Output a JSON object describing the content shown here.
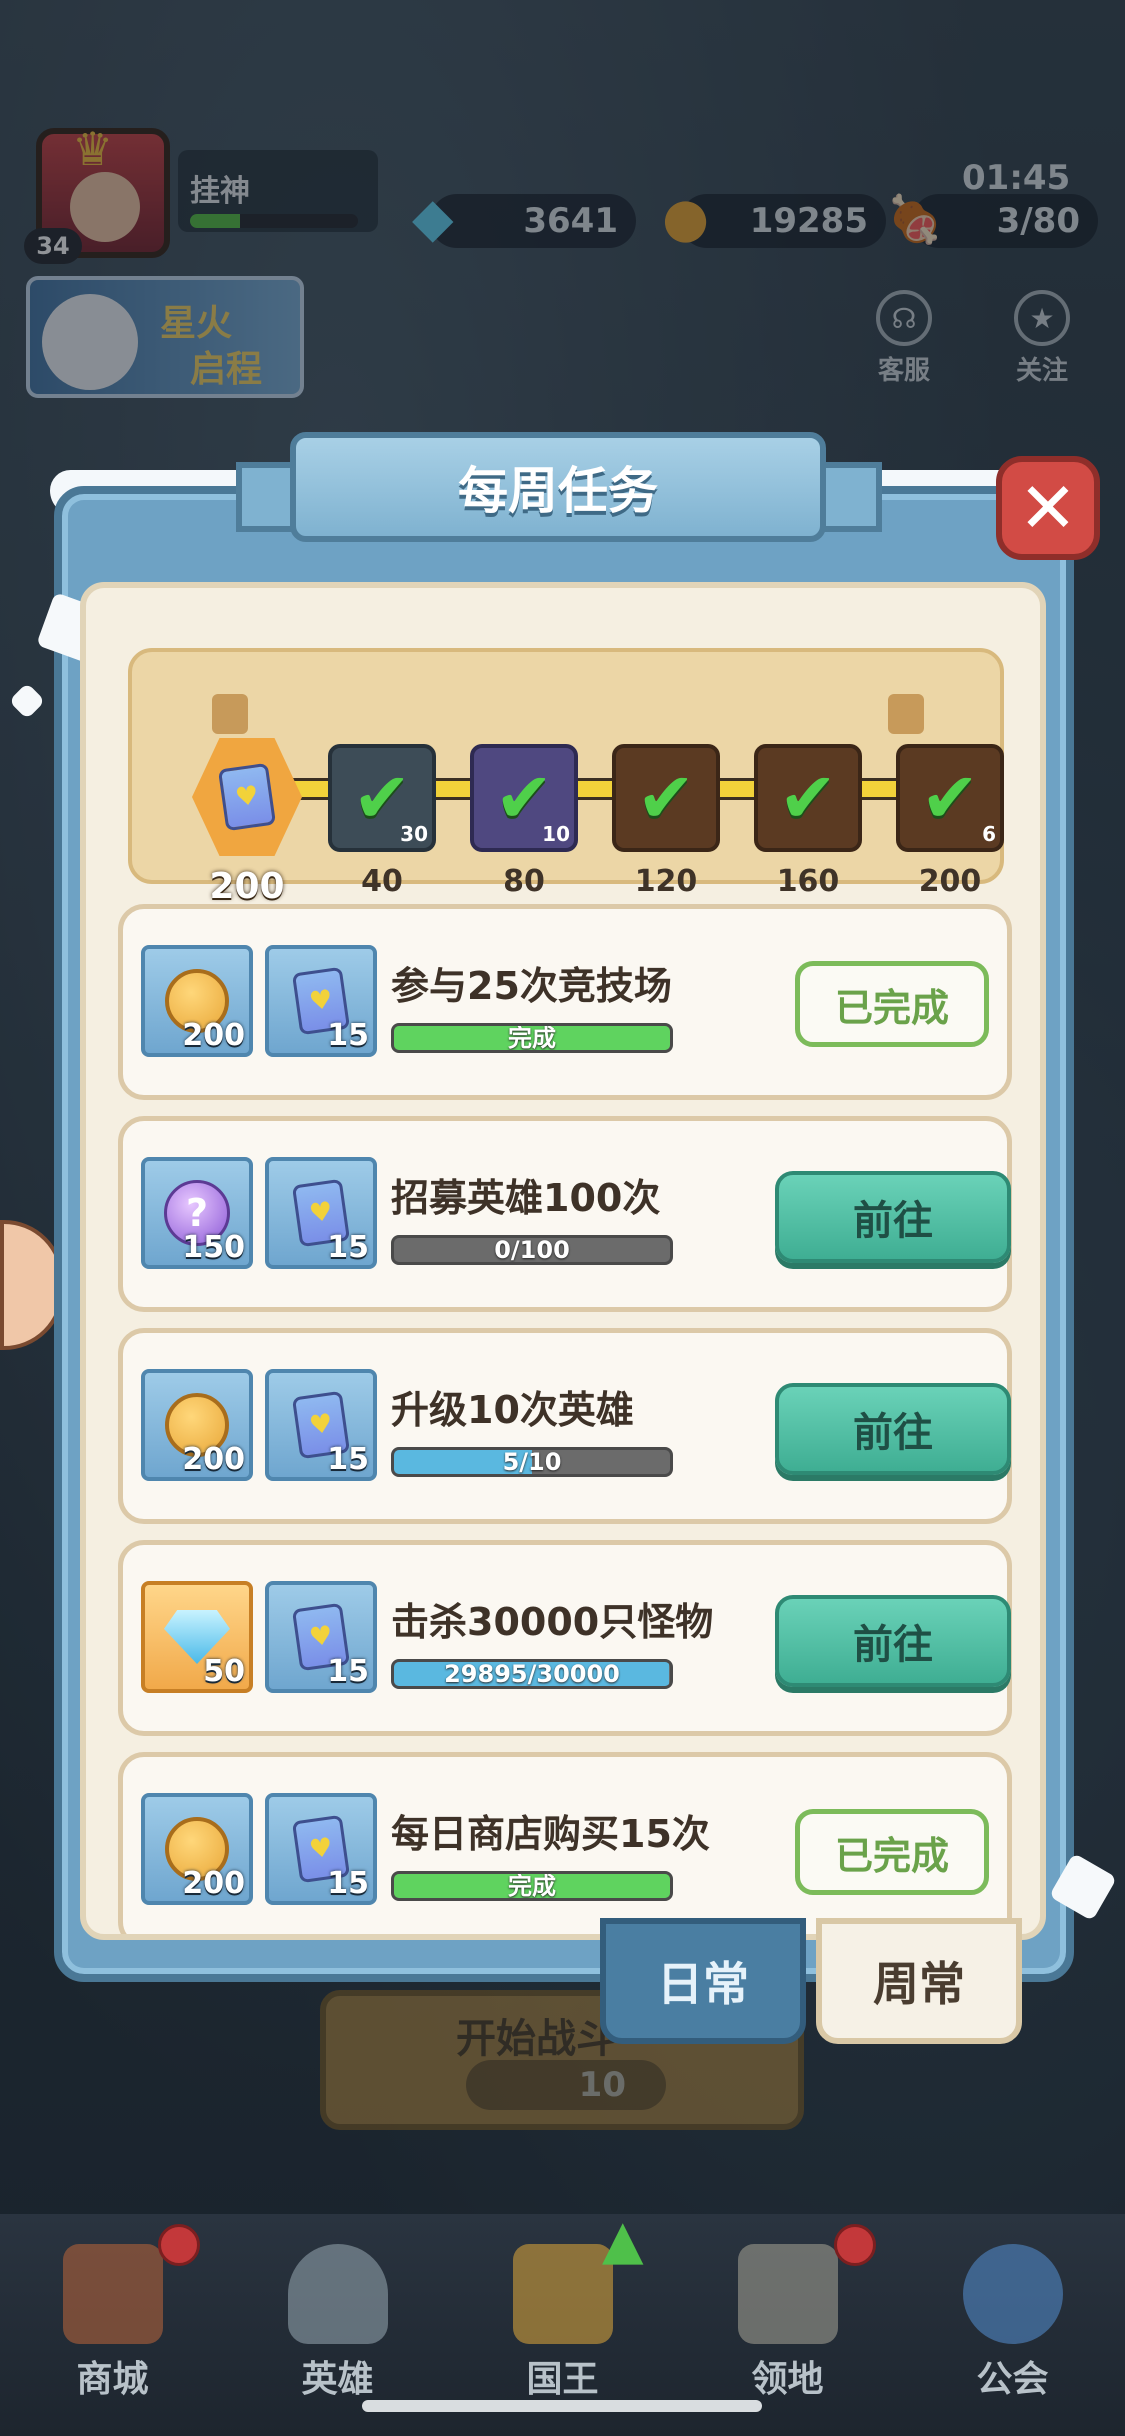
{
  "hud": {
    "level": "34",
    "name": "挂神",
    "gems": "3641",
    "gold": "19285",
    "meat": "3/80",
    "time": "01:45",
    "event_line1": "星火",
    "event_line2": "启程",
    "service_label": "客服",
    "follow_label": "关注"
  },
  "modal": {
    "title": "每周任务",
    "close_icon": "close-icon",
    "progress": {
      "current_value": "200",
      "milestones": [
        {
          "label": "40",
          "count": "30",
          "claimed": true
        },
        {
          "label": "80",
          "count": "10",
          "claimed": true
        },
        {
          "label": "120",
          "count": "",
          "claimed": true
        },
        {
          "label": "160",
          "count": "",
          "claimed": true
        },
        {
          "label": "200",
          "count": "6",
          "claimed": true
        }
      ]
    },
    "tasks": [
      {
        "title": "参与25次竞技场",
        "rewards": [
          {
            "icon": "gold-coin",
            "qty": "200"
          },
          {
            "icon": "hero-card",
            "qty": "15"
          }
        ],
        "progress_text": "完成",
        "progress_fraction": 1.0,
        "bar_color": "#5fd35f",
        "status": "done",
        "button_label": "已完成"
      },
      {
        "title": "招募英雄100次",
        "rewards": [
          {
            "icon": "mystery-orb",
            "qty": "150"
          },
          {
            "icon": "hero-card",
            "qty": "15"
          }
        ],
        "progress_text": "0/100",
        "progress_fraction": 0.0,
        "bar_color": "#5ab8e0",
        "status": "go",
        "button_label": "前往"
      },
      {
        "title": "升级10次英雄",
        "rewards": [
          {
            "icon": "gold-coin",
            "qty": "200"
          },
          {
            "icon": "hero-card",
            "qty": "15"
          }
        ],
        "progress_text": "5/10",
        "progress_fraction": 0.5,
        "bar_color": "#5ab8e0",
        "status": "go",
        "button_label": "前往"
      },
      {
        "title": "击杀30000只怪物",
        "rewards": [
          {
            "icon": "diamond",
            "qty": "50"
          },
          {
            "icon": "hero-card",
            "qty": "15"
          }
        ],
        "progress_text": "29895/30000",
        "progress_fraction": 0.9965,
        "bar_color": "#5ab8e0",
        "status": "go",
        "button_label": "前往"
      },
      {
        "title": "每日商店购买15次",
        "rewards": [
          {
            "icon": "gold-coin",
            "qty": "200"
          },
          {
            "icon": "hero-card",
            "qty": "15"
          }
        ],
        "progress_text": "完成",
        "progress_fraction": 1.0,
        "bar_color": "#5fd35f",
        "status": "done",
        "button_label": "已完成"
      }
    ],
    "tabs": {
      "daily": "日常",
      "weekly": "周常"
    }
  },
  "behind": {
    "start_cost": "10",
    "start_label": "开始战斗"
  },
  "nav": [
    {
      "label": "商城",
      "icon": "shop-icon",
      "badge": true
    },
    {
      "label": "英雄",
      "icon": "hero-helmet-icon",
      "badge": false
    },
    {
      "label": "国王",
      "icon": "crown-icon",
      "badge": false
    },
    {
      "label": "领地",
      "icon": "castle-icon",
      "badge": true
    },
    {
      "label": "公会",
      "icon": "planet-icon",
      "badge": false
    }
  ]
}
